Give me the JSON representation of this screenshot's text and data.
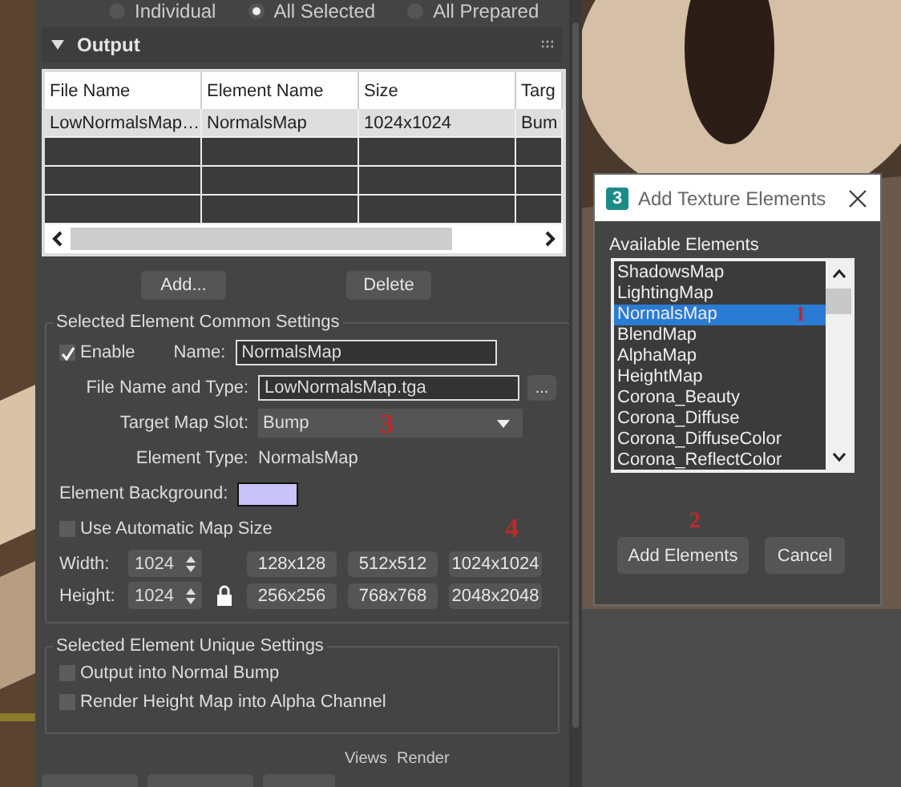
{
  "mode_radios": [
    {
      "label": "Individual",
      "selected": false
    },
    {
      "label": "All Selected",
      "selected": true
    },
    {
      "label": "All Prepared",
      "selected": false
    }
  ],
  "output": {
    "title": "Output",
    "expanded": true,
    "table": {
      "columns": [
        "File Name",
        "Element Name",
        "Size",
        "Targ"
      ],
      "rows": [
        {
          "cells": [
            "LowNormalsMap…",
            "NormalsMap",
            "1024x1024",
            "Bum"
          ],
          "selected": true
        }
      ]
    },
    "buttons": [
      "Add...",
      "Delete"
    ]
  },
  "common": {
    "title": "Selected Element Common Settings",
    "enable_label": "Enable",
    "enable_checked": true,
    "name_label": "Name:",
    "name_value": "NormalsMap",
    "file_label": "File Name and Type:",
    "file_value": "LowNormalsMap.tga",
    "browse_label": "...",
    "slot_label": "Target Map Slot:",
    "slot_value": "Bump",
    "slot_annotation": "3",
    "type_label": "Element Type:",
    "type_value": "NormalsMap",
    "background_label": "Element Background:",
    "auto_label": "Use Automatic Map Size",
    "auto_checked": false,
    "size_annotation": "4",
    "width_label": "Width:",
    "width_value": "1024",
    "height_label": "Height:",
    "height_value": "1024",
    "presets": [
      "128x128",
      "512x512",
      "1024x1024",
      "256x256",
      "768x768",
      "2048x2048"
    ]
  },
  "unique": {
    "title": "Selected Element Unique Settings",
    "options": [
      {
        "label": "Output into Normal Bump",
        "checked": false
      },
      {
        "label": "Render Height Map into Alpha Channel",
        "checked": false
      }
    ]
  },
  "footer": {
    "labels": [
      "Views",
      "Render"
    ]
  },
  "dialog": {
    "app_icon": "3",
    "title": "Add Texture Elements",
    "list_label": "Available Elements",
    "list_annotation": "1",
    "items": [
      {
        "label": "ShadowsMap",
        "selected": false
      },
      {
        "label": "LightingMap",
        "selected": false
      },
      {
        "label": "NormalsMap",
        "selected": true
      },
      {
        "label": "BlendMap",
        "selected": false
      },
      {
        "label": "AlphaMap",
        "selected": false
      },
      {
        "label": "HeightMap",
        "selected": false
      },
      {
        "label": "Corona_Beauty",
        "selected": false
      },
      {
        "label": "Corona_Diffuse",
        "selected": false
      },
      {
        "label": "Corona_DiffuseColor",
        "selected": false
      },
      {
        "label": "Corona_ReflectColor",
        "selected": false
      }
    ],
    "buttons_annotation": "2",
    "buttons": [
      "Add Elements",
      "Cancel"
    ]
  }
}
